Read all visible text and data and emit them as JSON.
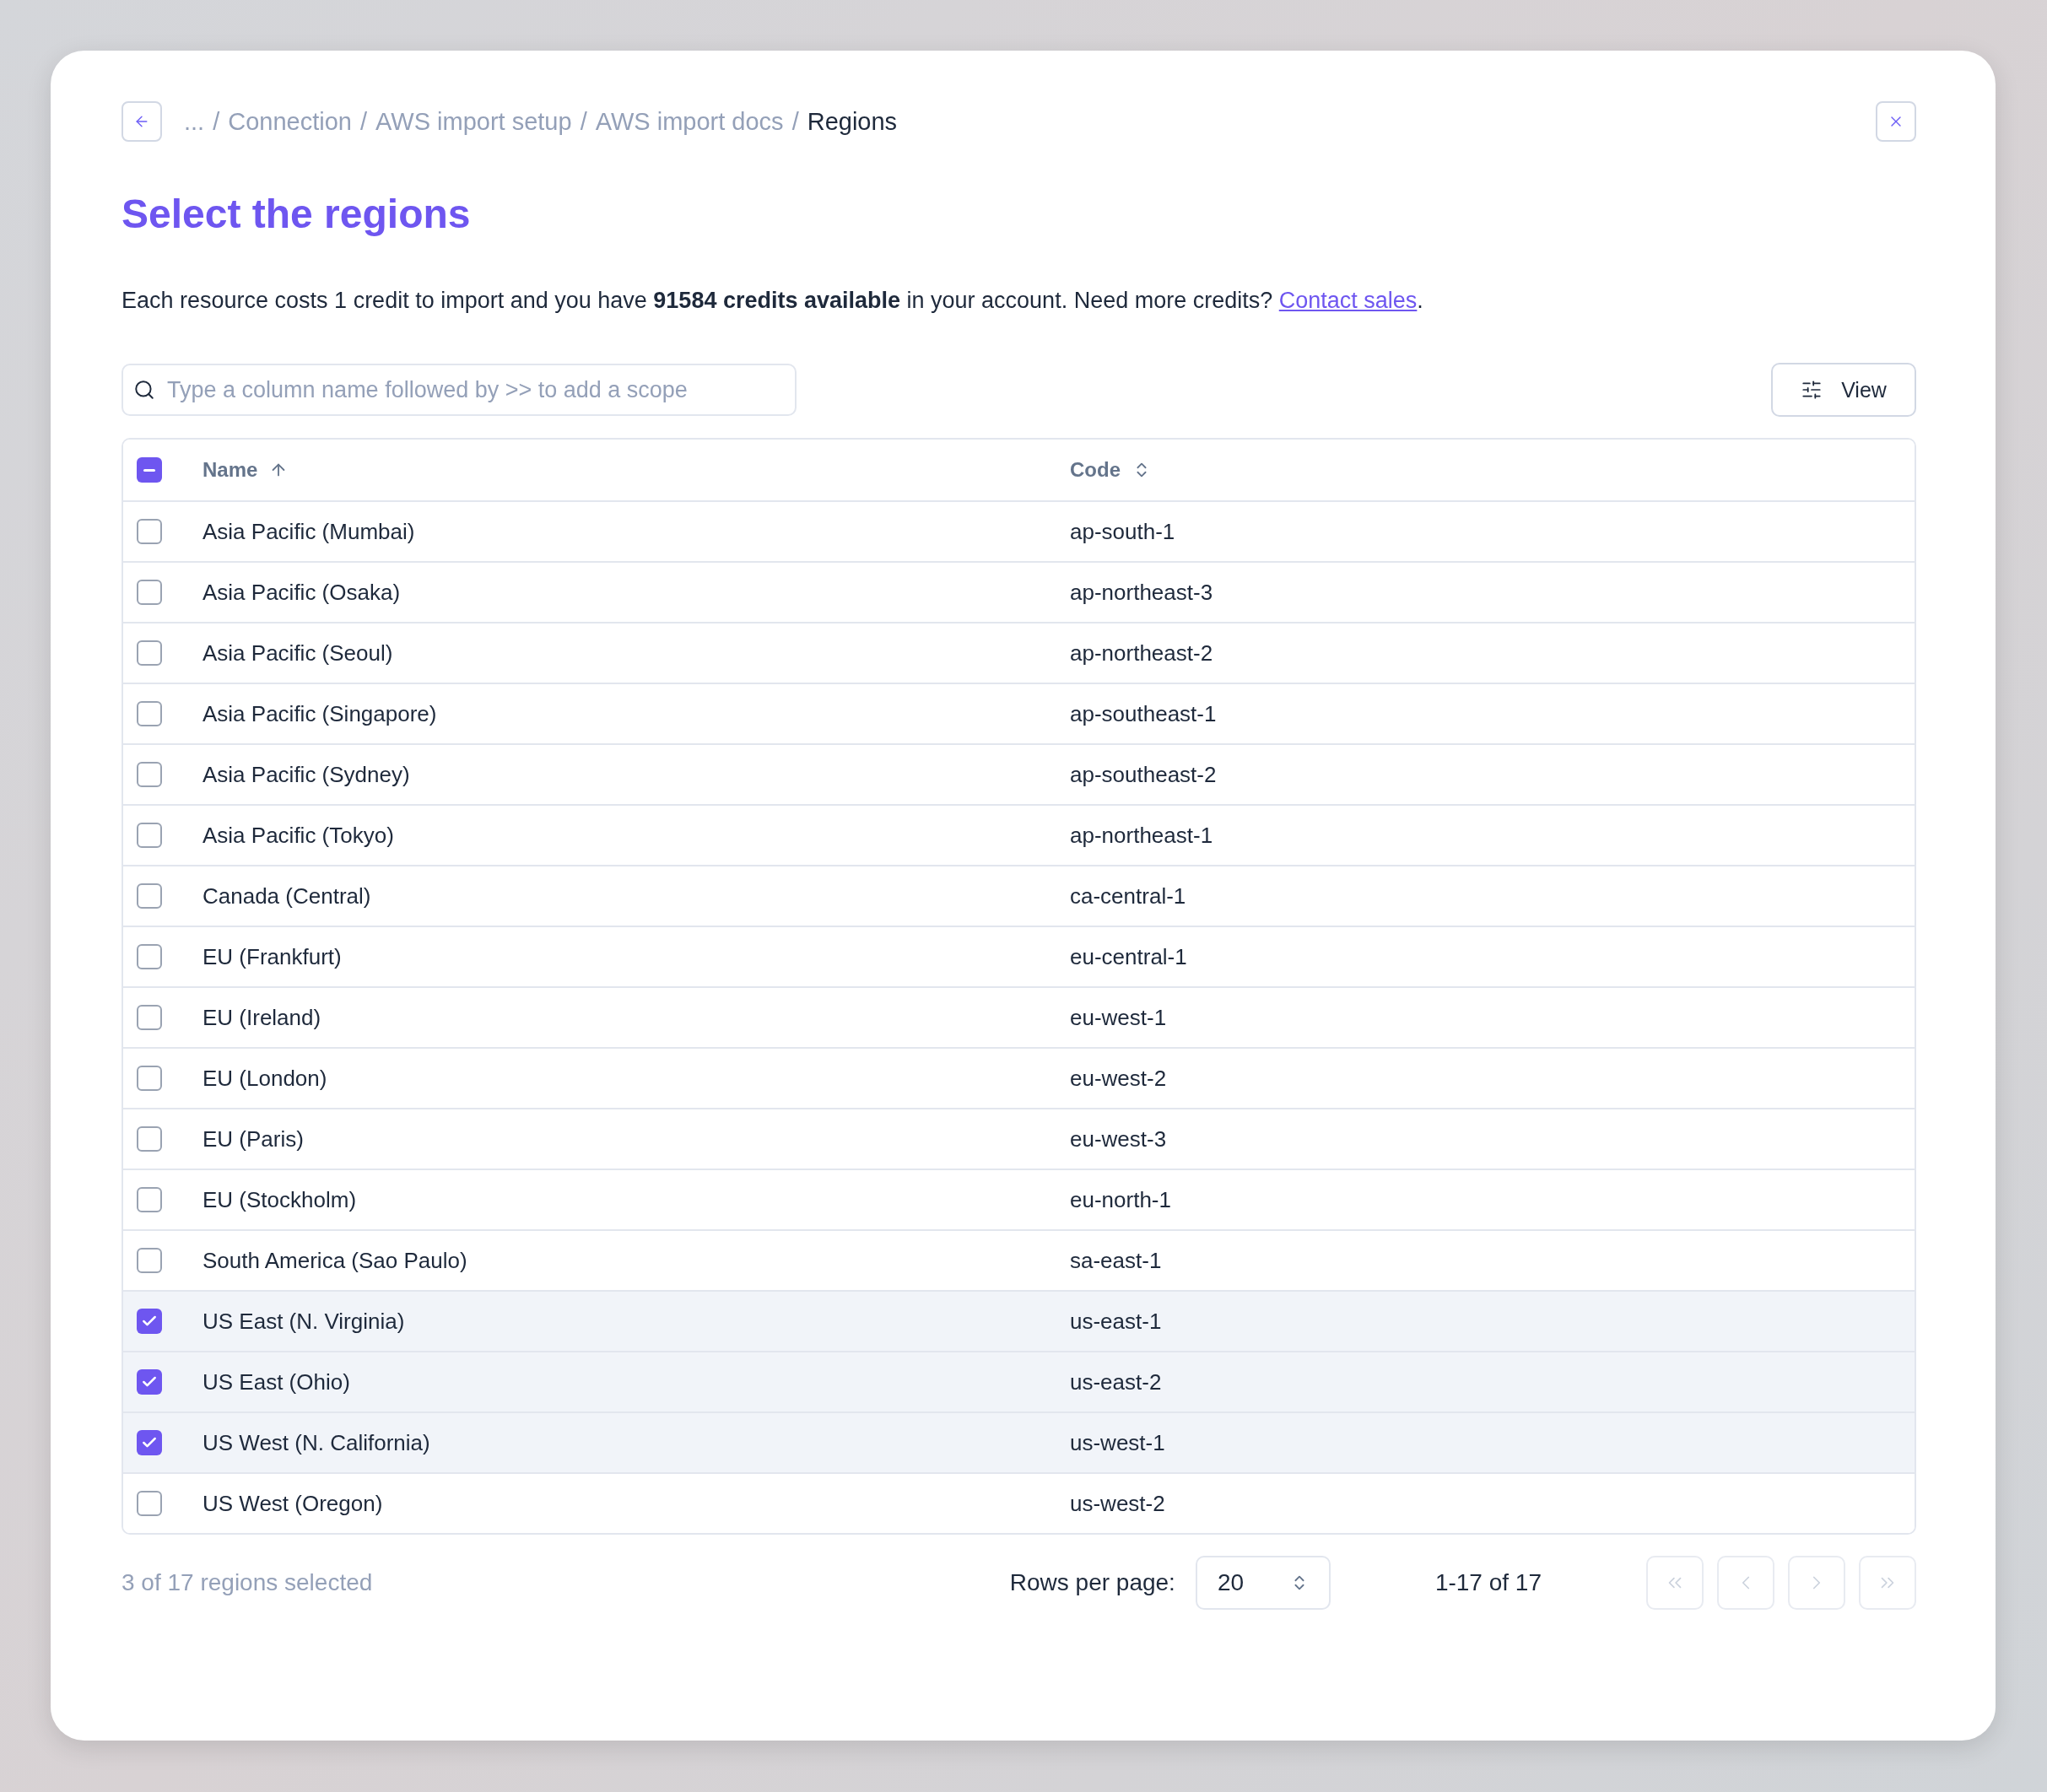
{
  "breadcrumb": [
    {
      "label": "...",
      "current": false
    },
    {
      "separator": "/",
      "label": "Connection",
      "current": false
    },
    {
      "separator": "/",
      "label": "AWS import setup",
      "current": false
    },
    {
      "separator": "/",
      "label": "AWS import docs",
      "current": false
    },
    {
      "separator": "/",
      "label": "Regions",
      "current": true
    }
  ],
  "title": "Select the regions",
  "description": {
    "text": "Each resource costs 1 credit to import and you have **91584 credits available** in your account. Need more credits?",
    "link": "Contact sales",
    "after": "."
  },
  "search": {
    "placeholder": "Type a column name followed by >> to add a scope"
  },
  "view_button": "View",
  "table": {
    "select_all": {
      "indeterminate": true
    },
    "columns": [
      {
        "label": "Name",
        "sorted": true
      },
      {
        "label": "Code",
        "sorted": false
      }
    ],
    "rows": [
      {
        "name": "Asia Pacific (Mumbai)",
        "code": "ap-south-1",
        "selected": false
      },
      {
        "name": "Asia Pacific (Osaka)",
        "code": "ap-northeast-3",
        "selected": false
      },
      {
        "name": "Asia Pacific (Seoul)",
        "code": "ap-northeast-2",
        "selected": false
      },
      {
        "name": "Asia Pacific (Singapore)",
        "code": "ap-southeast-1",
        "selected": false
      },
      {
        "name": "Asia Pacific (Sydney)",
        "code": "ap-southeast-2",
        "selected": false
      },
      {
        "name": "Asia Pacific (Tokyo)",
        "code": "ap-northeast-1",
        "selected": false
      },
      {
        "name": "Canada (Central)",
        "code": "ca-central-1",
        "selected": false
      },
      {
        "name": "EU (Frankfurt)",
        "code": "eu-central-1",
        "selected": false
      },
      {
        "name": "EU (Ireland)",
        "code": "eu-west-1",
        "selected": false
      },
      {
        "name": "EU (London)",
        "code": "eu-west-2",
        "selected": false
      },
      {
        "name": "EU (Paris)",
        "code": "eu-west-3",
        "selected": false
      },
      {
        "name": "EU (Stockholm)",
        "code": "eu-north-1",
        "selected": false
      },
      {
        "name": "South America (Sao Paulo)",
        "code": "sa-east-1",
        "selected": false
      },
      {
        "name": "US East (N. Virginia)",
        "code": "us-east-1",
        "selected": true
      },
      {
        "name": "US East (Ohio)",
        "code": "us-east-2",
        "selected": true
      },
      {
        "name": "US West (N. California)",
        "code": "us-west-1",
        "selected": true
      },
      {
        "name": "US West (Oregon)",
        "code": "us-west-2",
        "selected": false
      }
    ]
  },
  "footer": {
    "selection_count": "3 of 17 regions selected",
    "rows_per_page_label": "Rows per page:",
    "rows_per_page": "20",
    "range": "1-17 of 17",
    "pager": [
      {
        "kind": "first",
        "disabled": true
      },
      {
        "kind": "prev",
        "disabled": true
      },
      {
        "kind": "next",
        "disabled": true
      },
      {
        "kind": "last",
        "disabled": true
      }
    ]
  }
}
